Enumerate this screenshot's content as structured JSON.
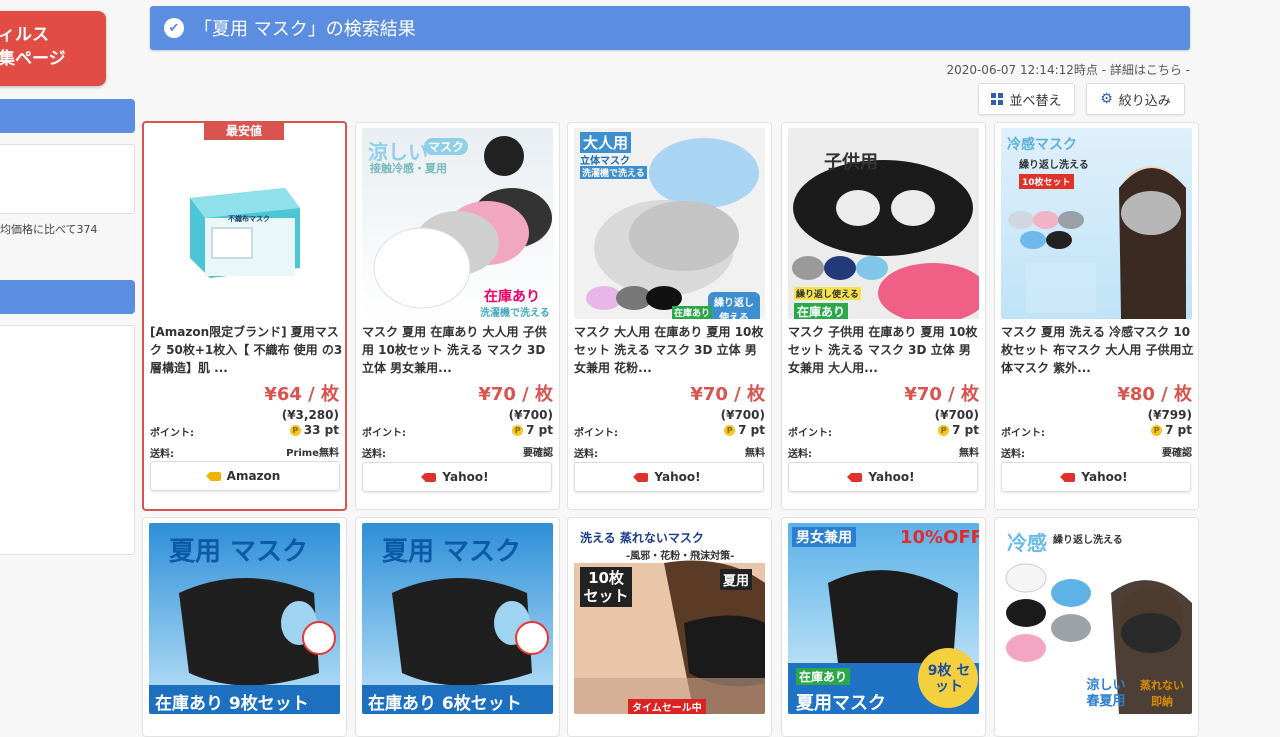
{
  "sidebar": {
    "banner_line1": "ィルス",
    "banner_line2": "集ページ",
    "compare_text": "均価格に比べて374"
  },
  "header": {
    "title": "「夏用 マスク」の検索結果"
  },
  "meta": {
    "timestamp": "2020-06-07 12:14:12時点 - 詳細はこちら -"
  },
  "toolbar": {
    "sort_label": "並べ替え",
    "filter_label": "絞り込み"
  },
  "labels": {
    "points": "ポイント:",
    "shipping": "送料:",
    "best_price": "最安値"
  },
  "products": [
    {
      "title": "[Amazon限定ブランド] 夏用マスク 50枚+1枚入【 不織布 使用 の3層構造】肌 ...",
      "price": "¥64 / 枚",
      "total": "(¥3,280)",
      "points": "33 pt",
      "shipping": "Prime無料",
      "shop": "Amazon"
    },
    {
      "title": "マスク 夏用 在庫あり 大人用 子供用 10枚セット 洗える マスク 3D 立体 男女兼用...",
      "price": "¥70 / 枚",
      "total": "(¥700)",
      "points": "7 pt",
      "shipping": "要確認",
      "shop": "Yahoo!"
    },
    {
      "title": "マスク 大人用 在庫あり 夏用 10枚セット 洗える マスク 3D 立体 男女兼用 花粉...",
      "price": "¥70 / 枚",
      "total": "(¥700)",
      "points": "7 pt",
      "shipping": "無料",
      "shop": "Yahoo!"
    },
    {
      "title": "マスク 子供用 在庫あり 夏用 10枚セット 洗える マスク 3D 立体 男女兼用 大人用...",
      "price": "¥70 / 枚",
      "total": "(¥700)",
      "points": "7 pt",
      "shipping": "無料",
      "shop": "Yahoo!"
    },
    {
      "title": "マスク 夏用 洗える 冷感マスク 10枚セット 布マスク 大人用 子供用立体マスク 紫外...",
      "price": "¥80 / 枚",
      "total": "(¥799)",
      "points": "7 pt",
      "shipping": "要確認",
      "shop": "Yahoo!"
    }
  ],
  "image_texts": {
    "p1_box": "不織布マスク",
    "p2_a": "涼しい",
    "p2_b": "マスク",
    "p2_c": "接触冷感・夏用",
    "p2_d": "在庫あり",
    "p2_e": "洗濯機で洗える",
    "p3_a": "大人用",
    "p3_b": "立体マスク",
    "p3_c": "洗濯機で洗える",
    "p3_d": "繰り返し使える",
    "p3_e": "在庫あり",
    "p4_a": "子供用",
    "p4_b": "在庫あり",
    "p4_c": "繰り返し使える",
    "p5_a": "冷感マスク",
    "p5_b": "繰り返し洗える",
    "p5_c": "10枚セット",
    "r2_1_a": "夏用 マスク",
    "r2_1_b": "在庫あり 9枚セット",
    "r2_2_a": "夏用 マスク",
    "r2_2_b": "在庫あり 6枚セット",
    "r2_3_a": "洗える 蒸れないマスク",
    "r2_3_b": "-風邪・花粉・飛沫対策-",
    "r2_3_c": "10枚 セット",
    "r2_3_d": "夏用",
    "r2_3_e": "タイムセール中",
    "r2_4_a": "男女兼用",
    "r2_4_b": "10%OFF",
    "r2_4_c": "在庫あり",
    "r2_4_d": "夏用マスク",
    "r2_4_e": "9枚 セット",
    "r2_5_a": "冷感",
    "r2_5_b": "繰り返し洗える",
    "r2_5_c": "涼しい 春夏用",
    "r2_5_d": "蒸れない 即納"
  },
  "colors": {
    "accent": "#5b8de0",
    "price": "#d9534f",
    "banner": "#e14c44"
  }
}
